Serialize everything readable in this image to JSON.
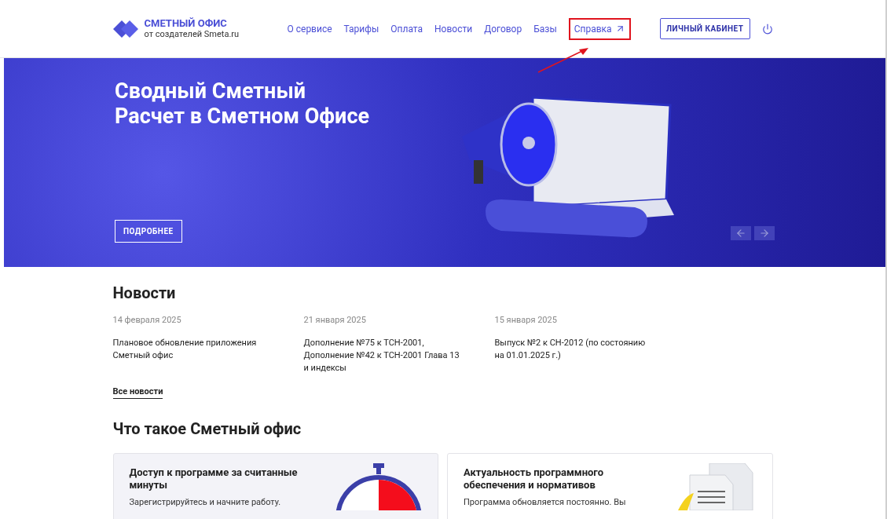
{
  "header": {
    "logo": {
      "title": "СМЕТНЫЙ ОФИС",
      "subtitle": "от создателей Smeta.ru"
    },
    "nav": [
      {
        "label": "О сервисе",
        "highlighted": false,
        "external": false
      },
      {
        "label": "Тарифы",
        "highlighted": false,
        "external": false
      },
      {
        "label": "Оплата",
        "highlighted": false,
        "external": false
      },
      {
        "label": "Новости",
        "highlighted": false,
        "external": false
      },
      {
        "label": "Договор",
        "highlighted": false,
        "external": false
      },
      {
        "label": "Базы",
        "highlighted": false,
        "external": false
      },
      {
        "label": "Справка",
        "highlighted": true,
        "external": true
      }
    ],
    "account_button": "ЛИЧНЫЙ КАБИНЕТ"
  },
  "hero": {
    "title": "Сводный Сметный\nРасчет в Сметном Офисе",
    "button": "ПОДРОБНЕЕ"
  },
  "news": {
    "title": "Новости",
    "items": [
      {
        "date": "14 февраля 2025",
        "text": "Плановое обновление приложения Сметный офис"
      },
      {
        "date": "21 января 2025",
        "text": "Дополнение №75 к ТСН-2001, Дополнение №42 к ТСН-2001 Глава 13 и индексы"
      },
      {
        "date": "15 января 2025",
        "text": "Выпуск №2 к СН-2012 (по состоянию на 01.01.2025 г.)"
      }
    ],
    "all_link": "Все новости"
  },
  "about": {
    "title": "Что такое Сметный офис",
    "cards": [
      {
        "kind": "timer",
        "title": "Доступ к программе за считанные минуты",
        "text": "Зарегистрируйтесь и начните работу."
      },
      {
        "kind": "documents",
        "title": "Актуальность программного обеспечения и нормативов",
        "text": "Программа обновляется постоянно. Вы"
      }
    ]
  }
}
